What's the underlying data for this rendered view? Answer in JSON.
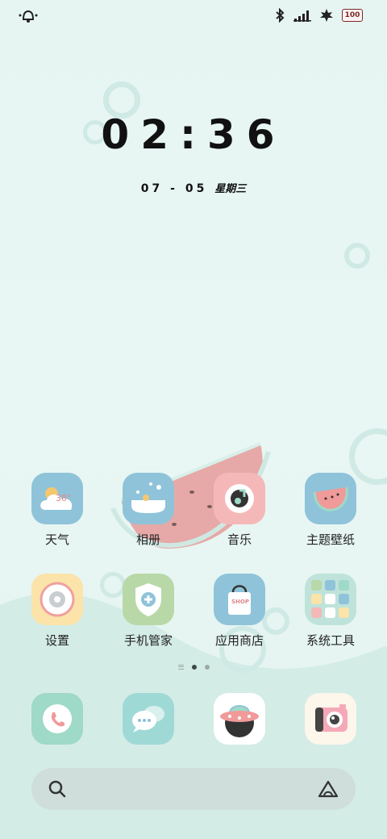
{
  "status_bar": {
    "battery_level": "100",
    "icons": [
      "bell-icon",
      "bluetooth-icon",
      "signal-icon",
      "leaf-icon",
      "battery-icon"
    ]
  },
  "clock": {
    "time": "02:36",
    "date": "07 - 05",
    "weekday": "星期三"
  },
  "apps": [
    {
      "label": "天气",
      "icon": "weather-icon",
      "temp": "38°"
    },
    {
      "label": "相册",
      "icon": "gallery-icon"
    },
    {
      "label": "音乐",
      "icon": "music-icon"
    },
    {
      "label": "主题壁纸",
      "icon": "theme-wallpaper-icon"
    },
    {
      "label": "设置",
      "icon": "settings-icon"
    },
    {
      "label": "手机管家",
      "icon": "phone-manager-icon"
    },
    {
      "label": "应用商店",
      "icon": "app-store-icon",
      "badge_text": "SHOP"
    },
    {
      "label": "系统工具",
      "icon": "system-tools-folder-icon"
    }
  ],
  "page_indicator": {
    "pages": 2,
    "active_page": 1
  },
  "dock": [
    "phone-icon",
    "messages-icon",
    "browser-icon",
    "camera-icon"
  ],
  "search": {
    "left_icon": "search-icon",
    "right_icon": "assistant-icon"
  },
  "colors": {
    "background": "#e7f6f3",
    "mint": "#9fd9c7",
    "blue": "#8fc3d9",
    "pink": "#f5b8b8",
    "yellow": "#fbe3a9",
    "green": "#b9d8a8"
  }
}
